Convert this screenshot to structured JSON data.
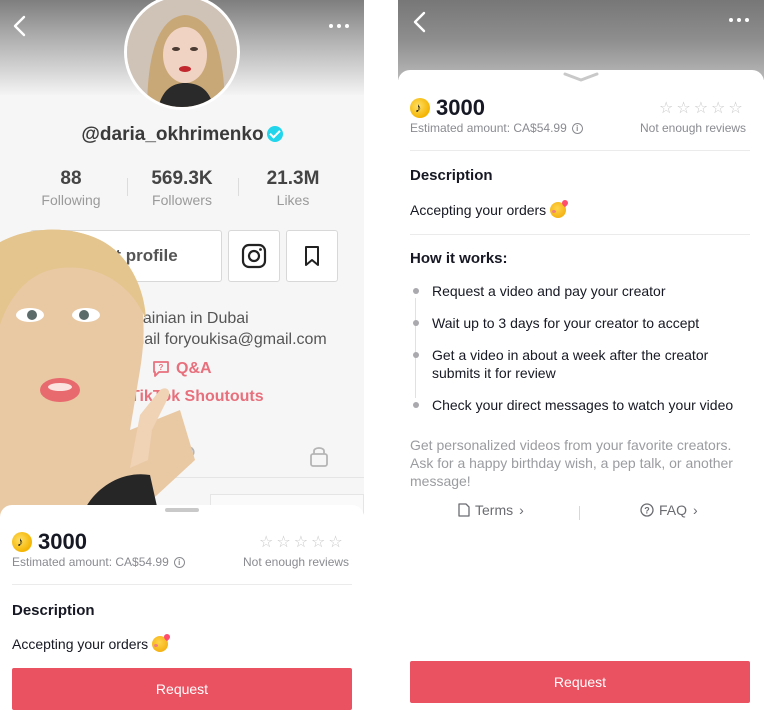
{
  "left": {
    "profile": {
      "username": "@daria_okhrimenko",
      "stats": [
        {
          "value": "88",
          "label": "Following"
        },
        {
          "value": "569.3K",
          "label": "Followers"
        },
        {
          "value": "21.3M",
          "label": "Likes"
        }
      ],
      "edit_profile_label": "dit profile",
      "bio_line1": "Ukrainian in Dubai",
      "bio_line2": "email foryoukisa@gmail.com",
      "qa_label": "Q&A",
      "shoutouts_label": "TikTok Shoutouts"
    },
    "sheet": {
      "coins": "3000",
      "estimated": "Estimated amount: CA$54.99",
      "reviews": "Not enough reviews",
      "description_title": "Description",
      "description_text": "Accepting your orders",
      "request_label": "Request"
    }
  },
  "right": {
    "sheet": {
      "coins": "3000",
      "estimated": "Estimated amount: CA$54.99",
      "reviews": "Not enough reviews",
      "description_title": "Description",
      "description_text": "Accepting your orders",
      "how_title": "How it works:",
      "steps": [
        "Request a video and pay your creator",
        "Wait up to 3 days for your creator to accept",
        "Get a video in about a week after the creator submits it for review",
        "Check your direct messages to watch your video"
      ],
      "promo": "Get personalized videos from your favorite creators. Ask for a happy birthday wish, a pep talk, or another message!",
      "terms_label": "Terms",
      "faq_label": "FAQ",
      "request_label": "Request"
    }
  },
  "colors": {
    "accent": "#ea5261",
    "link_pink": "#e8707d",
    "verified": "#20d5ec",
    "coin": "#f4b400"
  }
}
